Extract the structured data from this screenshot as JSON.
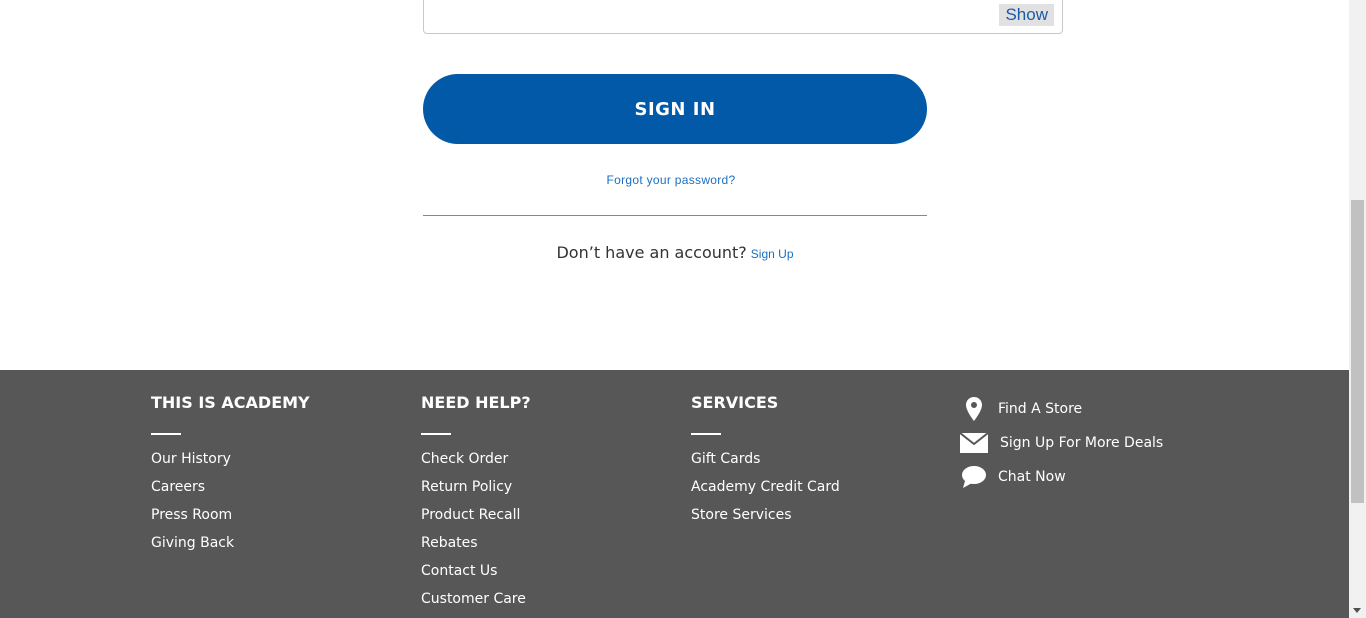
{
  "login": {
    "show_label": "Show",
    "signin_label": "SIGN IN",
    "forgot_label": "Forgot your password?",
    "no_account_text": "Don’t have an account?",
    "signup_label": "Sign Up"
  },
  "footer": {
    "col1": {
      "title": "THIS IS ACADEMY",
      "items": [
        "Our History",
        "Careers",
        "Press Room",
        "Giving Back"
      ]
    },
    "col2": {
      "title": "NEED HELP?",
      "items": [
        "Check Order",
        "Return Policy",
        "Product Recall",
        "Rebates",
        "Contact Us",
        "Customer Care"
      ]
    },
    "col3": {
      "title": "SERVICES",
      "items": [
        "Gift Cards",
        "Academy Credit Card",
        "Store Services"
      ]
    },
    "col4": {
      "items": [
        {
          "label": "Find A Store",
          "icon": "location-pin-icon"
        },
        {
          "label": "Sign Up For More Deals",
          "icon": "envelope-icon"
        },
        {
          "label": "Chat Now",
          "icon": "chat-bubble-icon"
        }
      ]
    }
  },
  "colors": {
    "primary": "#0159a8",
    "link": "#1a6fc4",
    "footer_bg": "#575757"
  }
}
